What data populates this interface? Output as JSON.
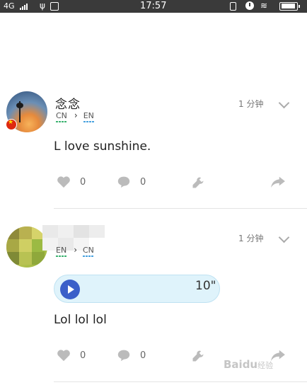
{
  "status_bar": {
    "network": "4G",
    "time": "17:57"
  },
  "posts": [
    {
      "name": "念念",
      "from_lang": "CN",
      "to_lang": "EN",
      "time": "1 分钟",
      "text": "L love sunshine.",
      "like_count": "0",
      "comment_count": "0"
    },
    {
      "name": "",
      "from_lang": "EN",
      "to_lang": "CN",
      "time": "1 分钟",
      "voice_duration": "10\"",
      "text": "Lol lol lol",
      "like_count": "0",
      "comment_count": "0"
    }
  ],
  "watermark": {
    "brand": "Baidu",
    "suffix": "经验"
  },
  "colors": {
    "status_bar": "#3a3a3a",
    "voice_bubble": "#dff3fb",
    "play_button": "#3b5fc9",
    "icon_gray": "#bbbbbb"
  }
}
